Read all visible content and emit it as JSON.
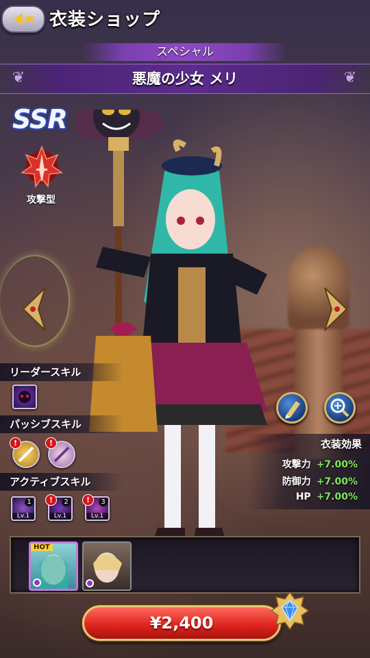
{
  "header": {
    "title": "衣装ショップ"
  },
  "costume": {
    "category": "スペシャル",
    "name": "悪魔の少女 メリ",
    "rarity": "SSR",
    "type": "攻撃型"
  },
  "skills": {
    "leader_label": "リーダースキル",
    "passive_label": "パッシブスキル",
    "active_label": "アクティブスキル",
    "alert_mark": "!",
    "active": [
      {
        "slot": "1",
        "level": "Lv.1"
      },
      {
        "slot": "2",
        "level": "Lv.1"
      },
      {
        "slot": "3",
        "level": "Lv.1"
      }
    ]
  },
  "effects": {
    "title": "衣装効果",
    "rows": [
      {
        "label": "攻撃力",
        "value": "+7.00%"
      },
      {
        "label": "防御力",
        "value": "+7.00%"
      },
      {
        "label": "HP",
        "value": "+7.00%"
      }
    ]
  },
  "thumbnails": {
    "hot_badge": "HOT"
  },
  "purchase": {
    "price": "¥2,400"
  },
  "colors": {
    "accent_purple": "#5c2c8c",
    "effect_green": "#7fe85a",
    "buy_red": "#e0261f"
  },
  "icons": [
    "back-arrow-icon",
    "attack-type-icon",
    "left-arrow-icon",
    "right-arrow-icon",
    "pen-icon",
    "zoom-plus-icon",
    "diamond-gem-icon"
  ]
}
